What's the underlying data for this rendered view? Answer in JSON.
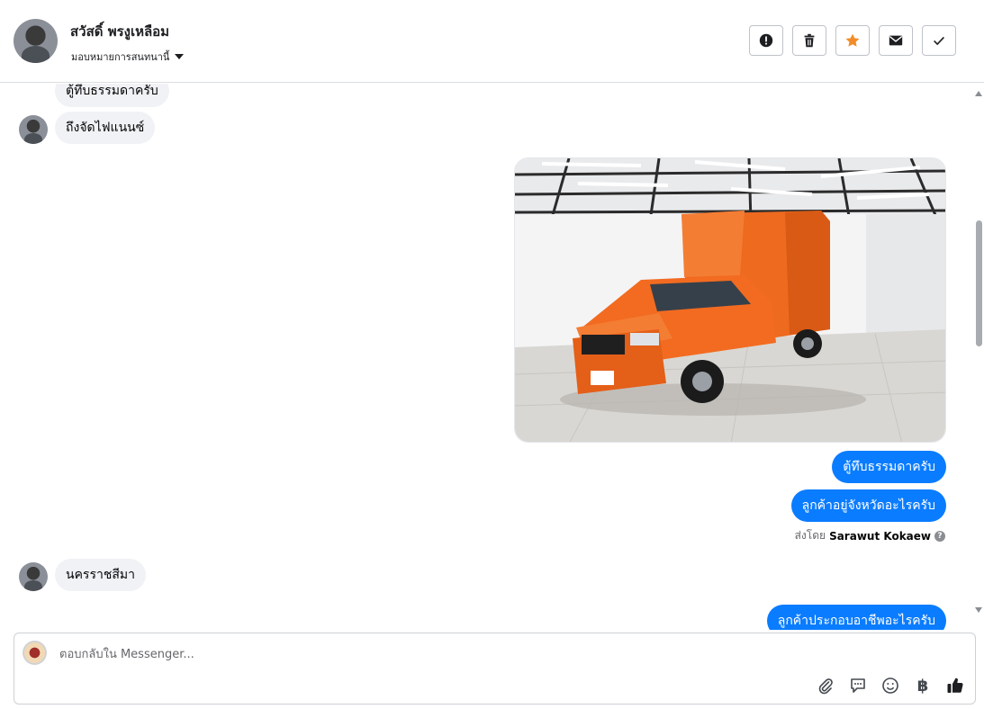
{
  "header": {
    "contact_name": "สวัสดิ์ พรงูเหลือม",
    "assign_label": "มอบหมายการสนทนานี้",
    "actions": [
      "report-spam",
      "delete",
      "star",
      "mark-unread",
      "mark-done"
    ]
  },
  "messages": {
    "in_1": "ตู้ทึบธรรมดาครับ",
    "in_2": "ถึงจัดไฟแนนซ์",
    "out_1": "ตู้ทึบธรรมดาครับ",
    "out_2": "ลูกค้าอยู่จังหวัดอะไรครับ",
    "sent_by_prefix": "ส่งโดย",
    "sent_by_name": "Sarawut Kokaew",
    "in_3": "นครราชสีมา",
    "out_3_partial": "ลูกค้าประกอบอาชีพอะไรครับ"
  },
  "composer": {
    "placeholder": "ตอบกลับใน Messenger...",
    "baht_symbol": "฿"
  },
  "colors": {
    "outgoing_bubble": "#0a7cff",
    "incoming_bubble": "#f0f2f5",
    "star": "#f28c28",
    "vehicle": "#f26b21"
  },
  "icons": [
    "alert-icon",
    "trash-icon",
    "star-icon",
    "envelope-icon",
    "check-icon",
    "paperclip-icon",
    "chat-bubble-icon",
    "smiley-icon",
    "baht-icon",
    "thumbs-up-icon"
  ]
}
